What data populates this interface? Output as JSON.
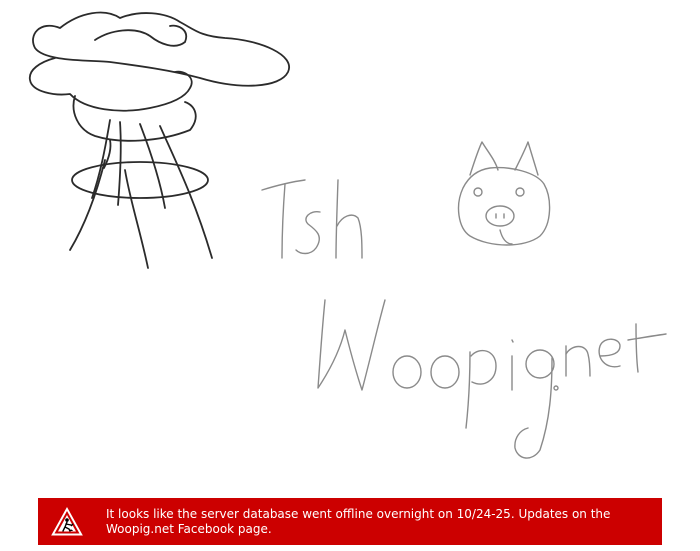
{
  "logo": {
    "alt_text": "Tsh Woopig.net",
    "line1": "Tsh",
    "line2": "Woopig.net"
  },
  "notice": {
    "icon": "road-works-warning-icon",
    "message": "It looks like the server database went offline overnight on 10/24-25. Updates on the Woopig.net Facebook page.",
    "background_color": "#cc0000",
    "text_color": "#ffffff"
  }
}
